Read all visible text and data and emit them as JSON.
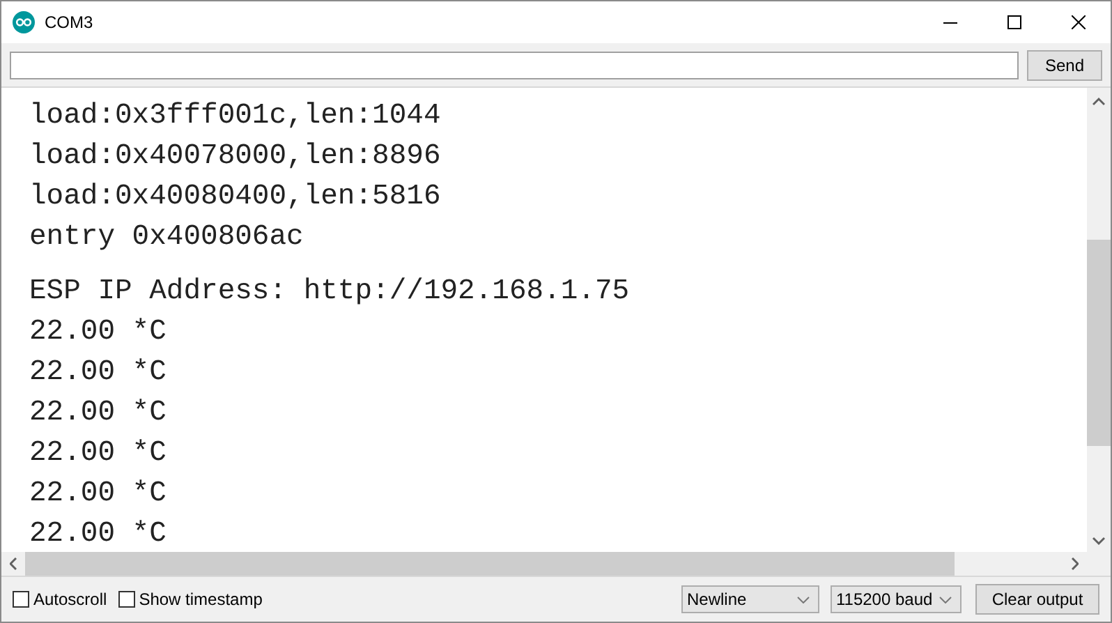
{
  "window": {
    "title": "COM3"
  },
  "send_button": "Send",
  "console": {
    "boot_log": [
      "load:0x3fff001c,len:1044",
      "load:0x40078000,len:8896",
      "load:0x40080400,len:5816",
      "entry 0x400806ac"
    ],
    "output": [
      "ESP IP Address: http://192.168.1.75",
      "22.00 *C",
      "22.00 *C",
      "22.00 *C",
      "22.00 *C",
      "22.00 *C",
      "22.00 *C"
    ]
  },
  "options": [
    {
      "label": "Autoscroll",
      "checked": false
    },
    {
      "label": "Show timestamp",
      "checked": false
    }
  ],
  "line_ending": "Newline",
  "baud_rate": "115200 baud",
  "clear_button": "Clear output"
}
